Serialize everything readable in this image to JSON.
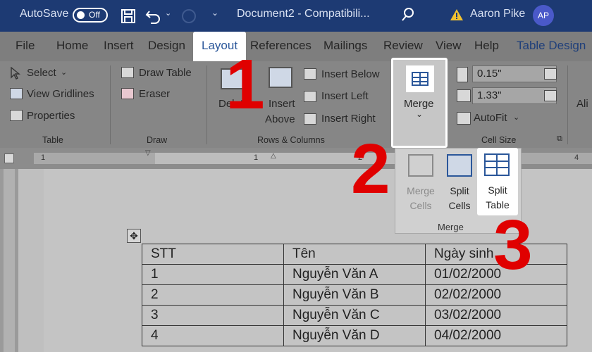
{
  "titlebar": {
    "autosave_label": "AutoSave",
    "autosave_state": "Off",
    "document_title": "Document2  -  Compatibili...",
    "user_name": "Aaron Pike",
    "user_initials": "AP"
  },
  "menu": {
    "tabs": [
      "File",
      "Home",
      "Insert",
      "Design",
      "Layout",
      "References",
      "Mailings",
      "Review",
      "View",
      "Help",
      "Table Design"
    ],
    "active_tab": "Layout"
  },
  "ribbon": {
    "table_group": {
      "select": "Select",
      "view_gridlines": "View Gridlines",
      "properties": "Properties",
      "label": "Table"
    },
    "draw_group": {
      "draw_table": "Draw Table",
      "eraser": "Eraser",
      "label": "Draw"
    },
    "rows_columns_group": {
      "delete": "Delete",
      "insert_above_1": "Insert",
      "insert_above_2": "Above",
      "insert_below": "Insert Below",
      "insert_left": "Insert Left",
      "insert_right": "Insert Right",
      "label": "Rows & Columns"
    },
    "merge_button": "Merge",
    "cell_size_group": {
      "height_value": "0.15\"",
      "width_value": "1.33\"",
      "autofit": "AutoFit",
      "label": "Cell Size"
    },
    "alignment_partial": "Ali"
  },
  "merge_dropdown": {
    "merge_cells_1": "Merge",
    "merge_cells_2": "Cells",
    "split_cells_1": "Split",
    "split_cells_2": "Cells",
    "split_table_1": "Split",
    "split_table_2": "Table",
    "label": "Merge"
  },
  "ruler": {
    "marks": [
      "1",
      "1",
      "2",
      "4"
    ]
  },
  "steps": [
    "1",
    "2",
    "3"
  ],
  "table": {
    "headers": [
      "STT",
      "Tên",
      "Ngày sinh"
    ],
    "rows": [
      [
        "1",
        "Nguyễn Văn A",
        "01/02/2000"
      ],
      [
        "2",
        "Nguyễn Văn B",
        "02/02/2000"
      ],
      [
        "3",
        "Nguyễn Văn C",
        "03/02/2000"
      ],
      [
        "4",
        "Nguyễn Văn D",
        "04/02/2000"
      ]
    ]
  },
  "colors": {
    "titlebar": "#1d3a73",
    "accent": "#2b579a",
    "step_red": "#e00000"
  }
}
